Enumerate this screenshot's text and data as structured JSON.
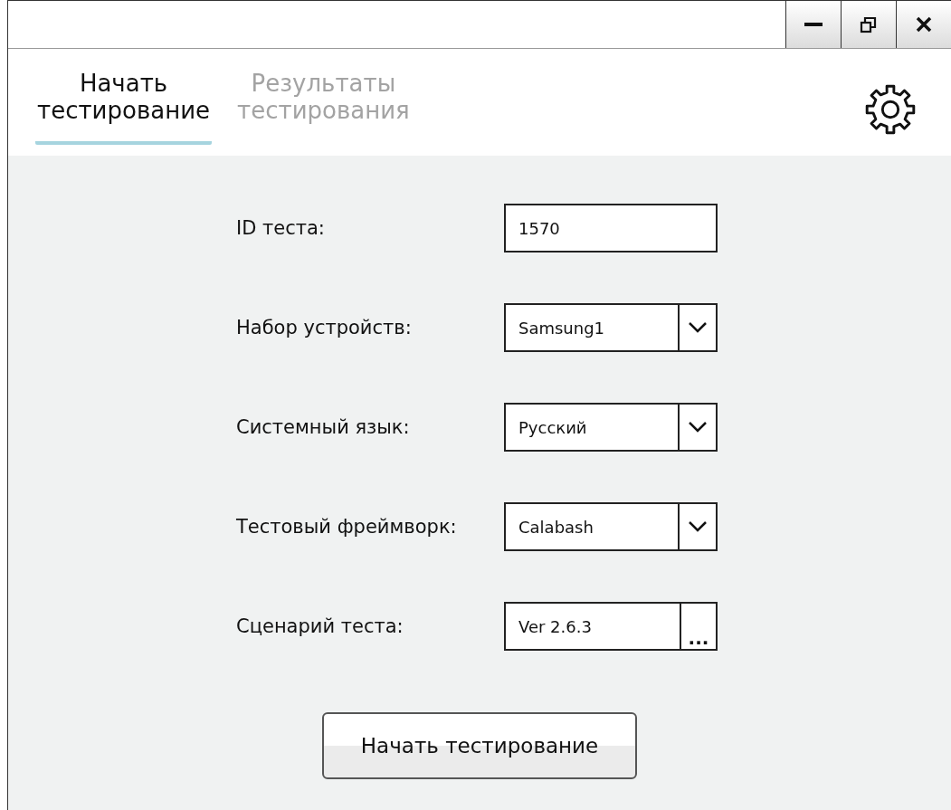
{
  "tabs": [
    {
      "label": "Начать\nтестирование",
      "selected": true
    },
    {
      "label": "Результаты\nтестирования",
      "selected": false
    }
  ],
  "form": [
    {
      "kind": "text",
      "label": "ID теста:",
      "value": "1570"
    },
    {
      "kind": "select",
      "label": "Набор устройств:",
      "value": "Samsung1"
    },
    {
      "kind": "select",
      "label": "Системный язык:",
      "value": "Русский"
    },
    {
      "kind": "select",
      "label": "Тестовый фреймворк:",
      "value": "Calabash"
    },
    {
      "kind": "browse",
      "label": "Сценарий теста:",
      "value": "Ver 2.6.3",
      "button": "..."
    }
  ],
  "start_button": "Начать тестирование"
}
